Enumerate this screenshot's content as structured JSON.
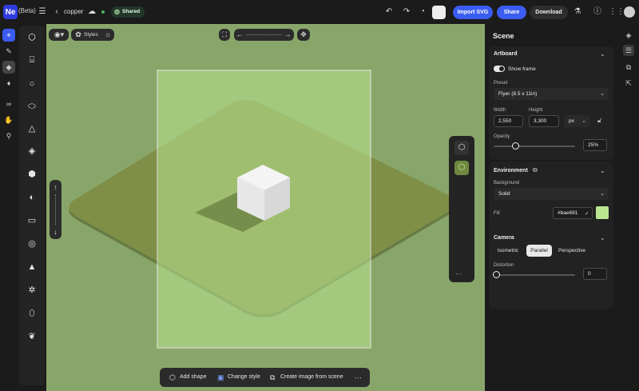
{
  "app": {
    "logo": "Ne",
    "beta": "(Beta)",
    "doc_name": "copper",
    "shared": "Shared"
  },
  "topbar": {
    "import_svg": "Import SVG",
    "share": "Share",
    "download": "Download"
  },
  "canvas_toolbar": {
    "styles": "Styles"
  },
  "bottom_bar": {
    "add_shape": "Add shape",
    "change_style": "Change style",
    "create_image": "Create image from scene",
    "more": "···"
  },
  "panel": {
    "title": "Scene",
    "artboard": {
      "title": "Artboard",
      "show_frame": "Show frame",
      "preset_label": "Preset",
      "preset_value": "Flyer (8.5 x 11in)",
      "width_label": "Width",
      "height_label": "Height",
      "width": "2,550",
      "height": "3,300",
      "unit": "px",
      "opacity_label": "Opacity",
      "opacity": "25%",
      "opacity_level": 0.25
    },
    "environment": {
      "title": "Environment",
      "background_label": "Background",
      "background_value": "Solid",
      "fill_label": "Fill",
      "fill_hex": "#bae691",
      "fill_color": "#bae691"
    },
    "camera": {
      "title": "Camera",
      "modes": [
        "Isometric",
        "Parallel",
        "Perspective"
      ],
      "active_mode": "Parallel",
      "distortion_label": "Distortion",
      "distortion": "0"
    }
  },
  "colors": {
    "canvas": "#89a66a",
    "artboard": "#bae691",
    "accent": "#3b5cf0"
  }
}
